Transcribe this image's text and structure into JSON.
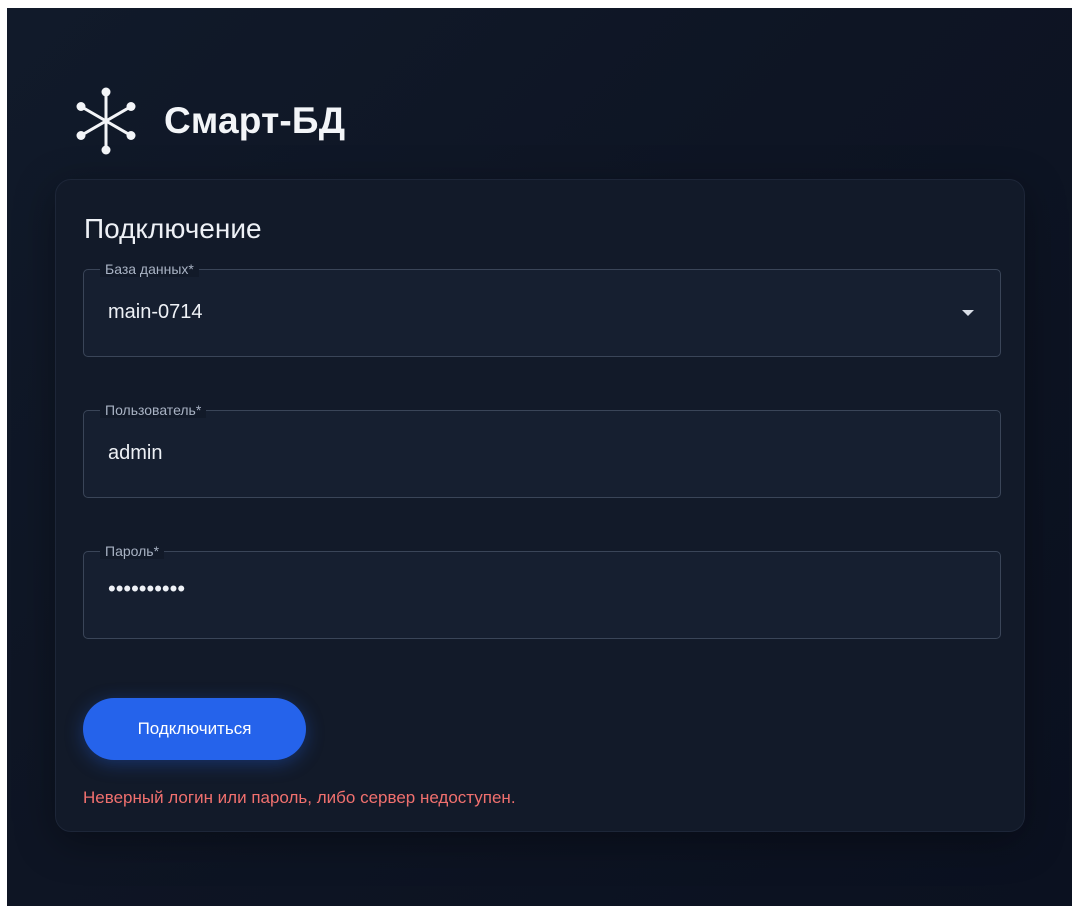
{
  "app": {
    "title": "Смарт-БД",
    "brand_icon": "snowflake-network-icon"
  },
  "card": {
    "title": "Подключение"
  },
  "form": {
    "database": {
      "label": "База данных*",
      "value": "main-0714"
    },
    "user": {
      "label": "Пользователь*",
      "value": "admin"
    },
    "password": {
      "label": "Пароль*",
      "value": "••••••••••"
    },
    "submit_label": "Подключиться",
    "error_message": "Неверный логин или пароль, либо сервер недоступен."
  },
  "colors": {
    "accent": "#2563eb",
    "error": "#f0706e",
    "background": "#0e1524"
  }
}
